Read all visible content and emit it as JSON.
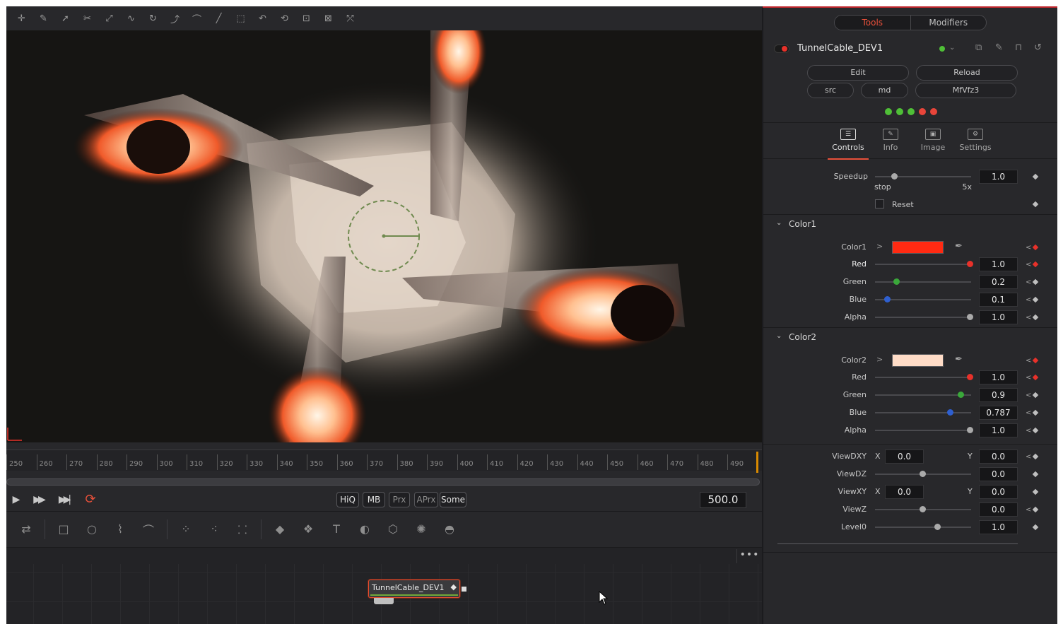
{
  "toolbar": {
    "icons": [
      "add-point-icon",
      "pencil-icon",
      "select-point-icon",
      "knife-icon",
      "multi-select-icon",
      "smooth-icon",
      "lasso-icon",
      "insert-icon",
      "bezier-icon",
      "line-icon",
      "rect-select-icon",
      "reverse-icon",
      "flip-icon",
      "transform-box-icon",
      "delete-icon",
      "publish-icon"
    ]
  },
  "timeline": {
    "ticks": [
      "250",
      "260",
      "270",
      "280",
      "290",
      "300",
      "310",
      "320",
      "330",
      "340",
      "350",
      "360",
      "370",
      "380",
      "390",
      "400",
      "410",
      "420",
      "430",
      "440",
      "450",
      "460",
      "470",
      "480",
      "490"
    ]
  },
  "transport": {
    "play_glyph": "▶",
    "ff_glyph": "▶▶",
    "end_glyph": "▶▶|",
    "loop_glyph": "⟳",
    "toggles": [
      {
        "label": "HiQ",
        "active": true
      },
      {
        "label": "MB",
        "active": true
      },
      {
        "label": "Prx",
        "active": false
      },
      {
        "label": "APrx",
        "active": false
      },
      {
        "label": "Some",
        "active": true
      }
    ],
    "current_frame": "500.0"
  },
  "nodebar": {
    "more": "•••"
  },
  "node": {
    "label": "TunnelCable_DEV1"
  },
  "inspector": {
    "tabs": {
      "tools": "Tools",
      "modifiers": "Modifiers"
    },
    "tool_name": "TunnelCable_DEV1",
    "buttons": {
      "edit": "Edit",
      "reload": "Reload",
      "src": "src",
      "md": "md",
      "link": "MfVfz3"
    },
    "status_dots": [
      "#4fbf37",
      "#4fbf37",
      "#4fbf37",
      "#e8453a",
      "#e8453a"
    ],
    "subtabs": [
      {
        "label": "Controls",
        "glyph": "☰",
        "active": true
      },
      {
        "label": "Info",
        "glyph": "✎",
        "active": false
      },
      {
        "label": "Image",
        "glyph": "▣",
        "active": false
      },
      {
        "label": "Settings",
        "glyph": "⚙",
        "active": false
      }
    ],
    "speedup": {
      "label": "Speedup",
      "value": "1.0",
      "min_label": "stop",
      "max_label": "5x",
      "fraction": 0.2
    },
    "reset": {
      "label": "Reset"
    },
    "color1": {
      "section": "Color1",
      "label": "Color1",
      "swatch": "#ff2a12",
      "red": {
        "label": "Red",
        "value": "1.0"
      },
      "green": {
        "label": "Green",
        "value": "0.2"
      },
      "blue": {
        "label": "Blue",
        "value": "0.1"
      },
      "alpha": {
        "label": "Alpha",
        "value": "1.0"
      }
    },
    "color2": {
      "section": "Color2",
      "label": "Color2",
      "swatch": "#ffdcc7",
      "red": {
        "label": "Red",
        "value": "1.0"
      },
      "green": {
        "label": "Green",
        "value": "0.9"
      },
      "blue": {
        "label": "Blue",
        "value": "0.787"
      },
      "alpha": {
        "label": "Alpha",
        "value": "1.0"
      }
    },
    "view": {
      "viewdxy": {
        "label": "ViewDXY",
        "x_label": "X",
        "x": "0.0",
        "y_label": "Y",
        "y": "0.0"
      },
      "viewdz": {
        "label": "ViewDZ",
        "value": "0.0"
      },
      "viewxy": {
        "label": "ViewXY",
        "x_label": "X",
        "x": "0.0",
        "y_label": "Y",
        "y": "0.0"
      },
      "viewz": {
        "label": "ViewZ",
        "value": "0.0"
      },
      "level0": {
        "label": "Level0",
        "value": "1.0"
      }
    }
  }
}
